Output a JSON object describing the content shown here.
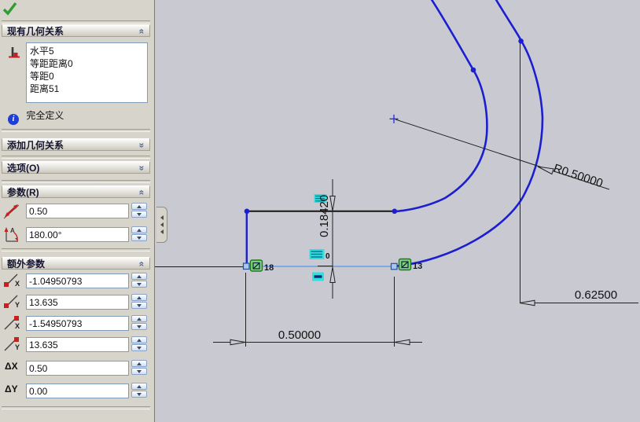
{
  "panel": {
    "existing_relations": {
      "title": "现有几何关系",
      "items": [
        "水平5",
        "等距距离0",
        "等距0",
        "距离51"
      ],
      "status": "完全定义"
    },
    "add_relations": {
      "title": "添加几何关系"
    },
    "options": {
      "title": "选项(O)"
    },
    "parameters": {
      "title": "参数(R)",
      "length": "0.50",
      "angle": "180.00°",
      "angle_icon_label": "A"
    },
    "extra_parameters": {
      "title": "额外参数",
      "start_x": "-1.04950793",
      "start_y": "13.635",
      "end_x": "-1.54950793",
      "end_y": "13.635",
      "delta_x_label": "ΔX",
      "delta_x": "0.50",
      "delta_y_label": "ΔY",
      "delta_y": "0.00",
      "axis_labels": [
        "X",
        "Y",
        "X",
        "Y"
      ]
    }
  },
  "canvas": {
    "dim_radius": "R0.50000",
    "dim_height": "0.18420",
    "dim_width": "0.50000",
    "dim_offset": "0.62500",
    "badge_left": "18",
    "badge_right": "13",
    "relation_zero": "0"
  },
  "colors": {
    "sketch_blue": "#1b1fd0",
    "construction_light_blue": "#7fa8e4",
    "relation_green": "#7cd47c",
    "highlight_cyan": "#2ee0e0",
    "canvas_bg": "#c9cad1",
    "panel_bg": "#d7d4cc"
  }
}
